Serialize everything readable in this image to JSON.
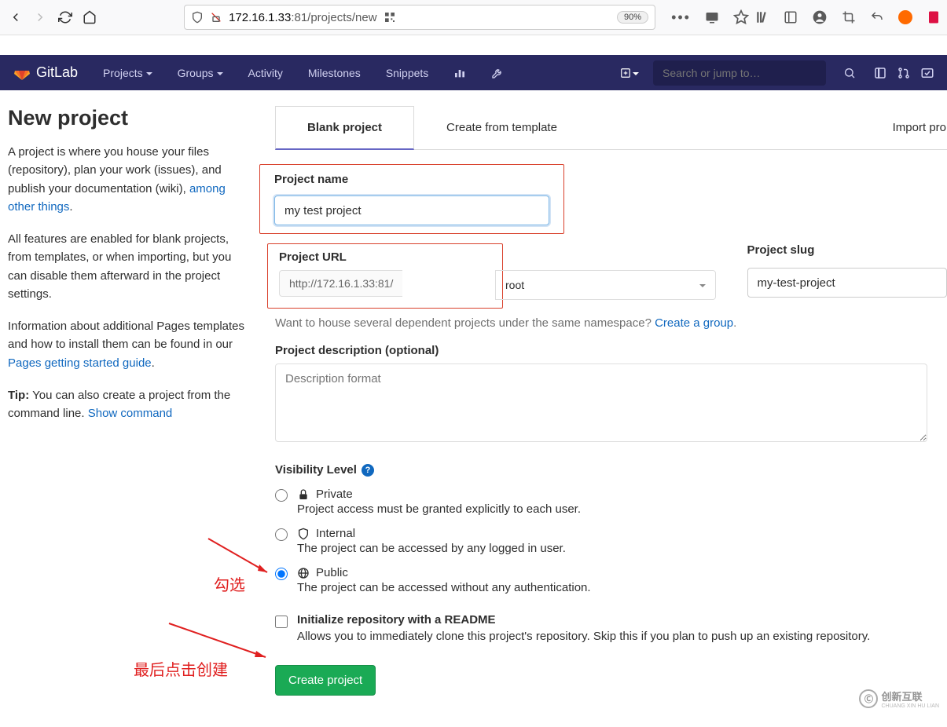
{
  "browser": {
    "url_prefix": "172.16.1.33",
    "url_port": ":81",
    "url_path": "/projects/new",
    "zoom": "90%"
  },
  "nav": {
    "brand": "GitLab",
    "projects": "Projects",
    "groups": "Groups",
    "activity": "Activity",
    "milestones": "Milestones",
    "snippets": "Snippets",
    "search_placeholder": "Search or jump to…"
  },
  "sidebar": {
    "title": "New project",
    "p1a": "A project is where you house your files (repository), plan your work (issues), and publish your documentation (wiki), ",
    "p1link": "among other things",
    "p2": "All features are enabled for blank projects, from templates, or when importing, but you can disable them afterward in the project settings.",
    "p3a": "Information about additional Pages templates and how to install them can be found in our ",
    "p3link": "Pages getting started guide",
    "p4bold": "Tip:",
    "p4a": " You can also create a project from the command line. ",
    "p4link": "Show command"
  },
  "tabs": {
    "blank": "Blank project",
    "template": "Create from template",
    "import": "Import pro"
  },
  "form": {
    "name_label": "Project name",
    "name_value": "my test project",
    "url_label": "Project URL",
    "url_base": "http://172.16.1.33:81/",
    "url_namespace": "root",
    "slug_label": "Project slug",
    "slug_value": "my-test-project",
    "namespace_hint_a": "Want to house several dependent projects under the same namespace? ",
    "namespace_hint_link": "Create a group",
    "desc_label": "Project description (optional)",
    "desc_placeholder": "Description format",
    "vis_label": "Visibility Level",
    "private_title": "Private",
    "private_desc": "Project access must be granted explicitly to each user.",
    "internal_title": "Internal",
    "internal_desc": "The project can be accessed by any logged in user.",
    "public_title": "Public",
    "public_desc": "The project can be accessed without any authentication.",
    "readme_label": "Initialize repository with a README",
    "readme_desc": "Allows you to immediately clone this project's repository. Skip this if you plan to push up an existing repository.",
    "submit": "Create project"
  },
  "annotations": {
    "select": "勾选",
    "create": "最后点击创建"
  },
  "watermark": {
    "brand": "创新互联",
    "sub": "CHUANG XIN HU LIAN"
  }
}
